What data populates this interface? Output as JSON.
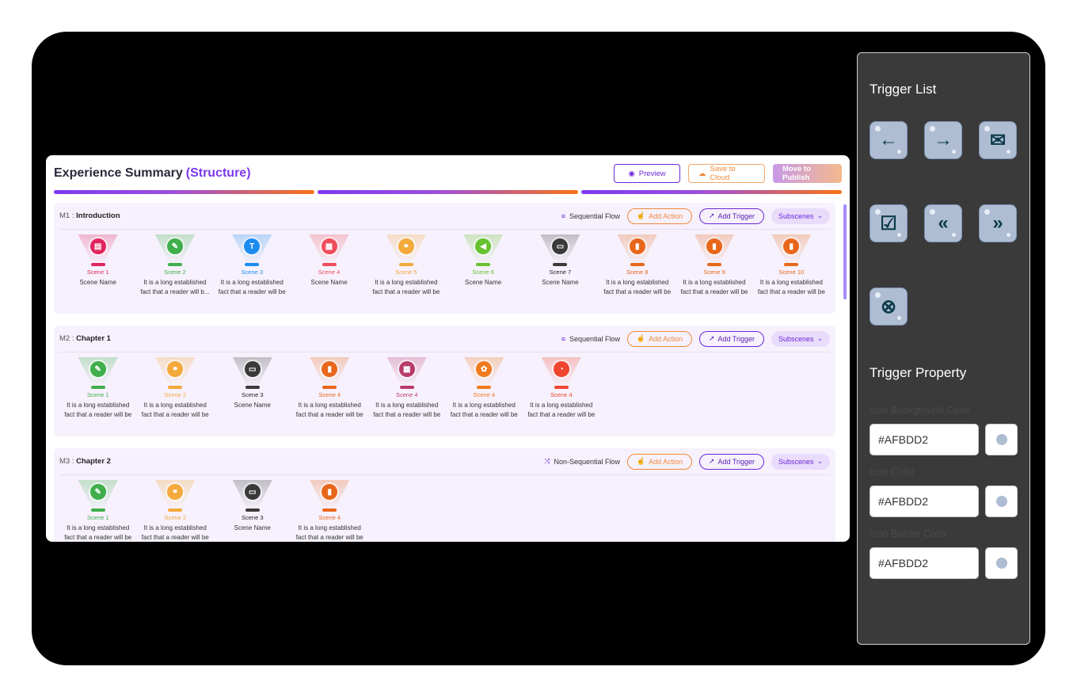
{
  "summary": {
    "title": "Experience Summary",
    "title_accent": "(Structure)",
    "preview_label": "Preview",
    "save_label": "Save to Cloud",
    "publish_label": "Move to Publish"
  },
  "buttons": {
    "add_action": "Add Action",
    "add_trigger": "Add Trigger",
    "subscenes": "Subscenes"
  },
  "modules": [
    {
      "prefix": "M1 : ",
      "name": "Introduction",
      "flow": "Sequential Flow",
      "scenes": [
        {
          "label": "Scene 1",
          "desc": "Scene Name",
          "color": "#e0245e",
          "icon": "▤"
        },
        {
          "label": "Scene 2",
          "desc": "It is a long established fact that a reader will b...",
          "color": "#3fae4b",
          "icon": "✎"
        },
        {
          "label": "Scene 3",
          "desc": "It is a long established fact that a reader will be",
          "color": "#1d8cf0",
          "icon": "T"
        },
        {
          "label": "Scene 4",
          "desc": "Scene Name",
          "color": "#ef4d5b",
          "icon": "▦"
        },
        {
          "label": "Scene 5",
          "desc": "It is a long established fact that a reader will be",
          "color": "#f3a93b",
          "icon": "⚭"
        },
        {
          "label": "Scene 6",
          "desc": "Scene Name",
          "color": "#66c22e",
          "icon": "◀"
        },
        {
          "label": "Scene 7",
          "desc": "Scene Name",
          "color": "#3a3a3a",
          "icon": "▭"
        },
        {
          "label": "Scene 8",
          "desc": "It is a long established fact that a reader will be",
          "color": "#e8671b",
          "icon": "▮"
        },
        {
          "label": "Scene 9",
          "desc": "It is a long established fact that a reader will be",
          "color": "#e8671b",
          "icon": "▮"
        },
        {
          "label": "Scene 10",
          "desc": "It is a long established fact that a reader will be",
          "color": "#e8671b",
          "icon": "▮"
        }
      ]
    },
    {
      "prefix": "M2 : ",
      "name": "Chapter 1",
      "flow": "Sequential Flow",
      "scenes": [
        {
          "label": "Scene 1",
          "desc": "It is a long established fact that a reader will be",
          "color": "#3fae4b",
          "icon": "✎"
        },
        {
          "label": "Scene 2",
          "desc": "It is a long established fact that a reader will be",
          "color": "#f3a93b",
          "icon": "⚭"
        },
        {
          "label": "Scene 3",
          "desc": "Scene Name",
          "color": "#3a3a3a",
          "icon": "▭"
        },
        {
          "label": "Scene 4",
          "desc": "It is a long established fact that a reader will be",
          "color": "#e8671b",
          "icon": "▮"
        },
        {
          "label": "Scene 4",
          "desc": "It is a long established fact that a reader will be",
          "color": "#b83a6a",
          "icon": "▦"
        },
        {
          "label": "Scene 4",
          "desc": "It is a long established fact that a reader will be",
          "color": "#f07a1e",
          "icon": "✿"
        },
        {
          "label": "Scene 4",
          "desc": "It is a long established fact that a reader will be",
          "color": "#f0452f",
          "icon": "◔"
        }
      ]
    },
    {
      "prefix": "M3 : ",
      "name": "Chapter 2",
      "flow": "Non-Sequential Flow",
      "scenes": [
        {
          "label": "Scene 1",
          "desc": "It is a long established fact that a reader will be",
          "color": "#3fae4b",
          "icon": "✎"
        },
        {
          "label": "Scene 2",
          "desc": "It is a long established fact that a reader will be",
          "color": "#f3a93b",
          "icon": "⚭"
        },
        {
          "label": "Scene 3",
          "desc": "Scene Name",
          "color": "#3a3a3a",
          "icon": "▭"
        },
        {
          "label": "Scene 4",
          "desc": "It is a long established fact that a reader will be",
          "color": "#e8671b",
          "icon": "▮"
        }
      ]
    }
  ],
  "panel": {
    "trigger_list_title": "Trigger List",
    "triggers": [
      {
        "name": "arrow-left-icon",
        "glyph": "←"
      },
      {
        "name": "arrow-right-icon",
        "glyph": "→"
      },
      {
        "name": "envelope-icon",
        "glyph": "✉"
      },
      {
        "name": "checkbox-icon",
        "glyph": "☑"
      },
      {
        "name": "double-chevron-left-icon",
        "glyph": "«"
      },
      {
        "name": "double-chevron-right-icon",
        "glyph": "»"
      },
      {
        "name": "close-circle-icon",
        "glyph": "⊗"
      }
    ],
    "trigger_property_title": "Trigger Property",
    "bg_color_label": "Icon Background Color",
    "bg_color_value": "#AFBDD2",
    "icon_color_label": "Icon Color",
    "icon_color_value": "#AFBDD2",
    "border_color_label": "Icon Border Color",
    "border_color_value": "#AFBDD2"
  }
}
